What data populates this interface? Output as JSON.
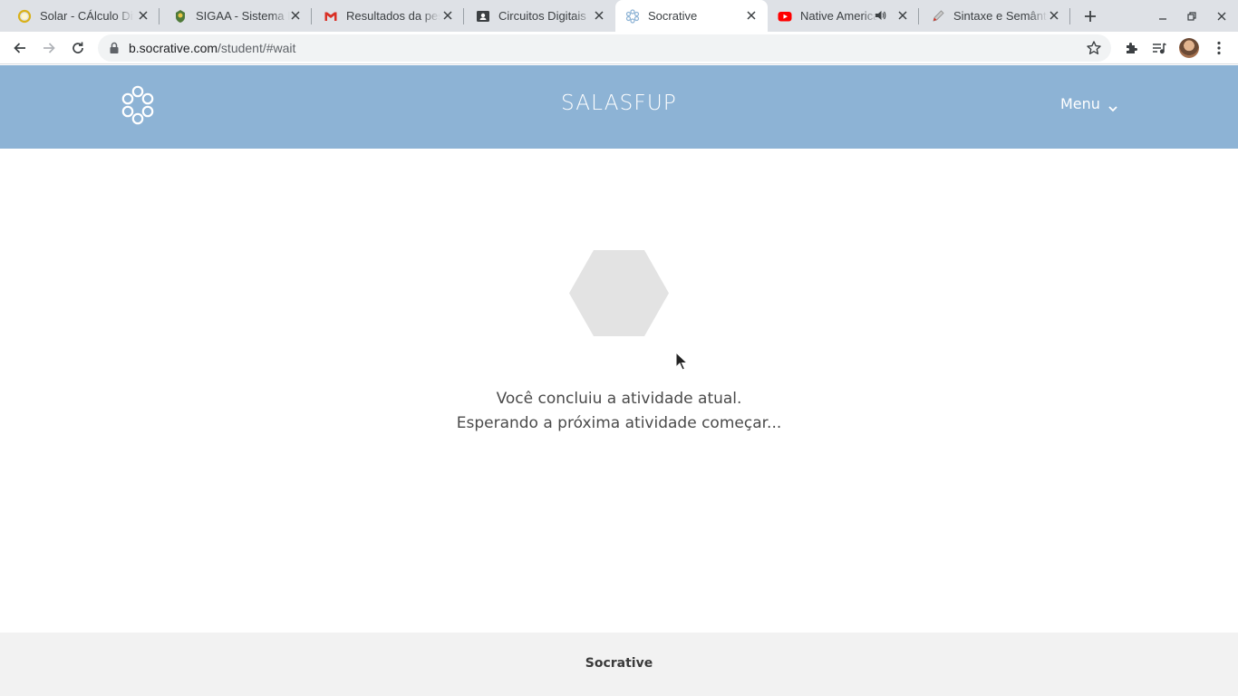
{
  "browser": {
    "tabs": [
      {
        "title": "Solar - CÁlculo Diferencial",
        "favicon": "solar-ring-icon",
        "active": false
      },
      {
        "title": "SIGAA - Sistema Integrado",
        "favicon": "sigaa-crest-icon",
        "active": false
      },
      {
        "title": "Resultados da pesquisa",
        "favicon": "gmail-icon",
        "active": false
      },
      {
        "title": "Circuitos Digitais",
        "favicon": "classroom-icon",
        "active": false
      },
      {
        "title": "Socrative",
        "favicon": "socrative-hex-icon",
        "active": true
      },
      {
        "title": "Native American",
        "favicon": "youtube-icon",
        "active": false,
        "audio": true
      },
      {
        "title": "Sintaxe e Semântica",
        "favicon": "pen-icon",
        "active": false
      }
    ],
    "url": {
      "domain": "b.socrative.com",
      "path": "/student/#wait"
    },
    "colors": {
      "tabstrip": "#dee1e6",
      "omnibox": "#f1f3f4"
    }
  },
  "header": {
    "room_name": "SALASFUP",
    "menu_label": "Menu",
    "background": "#8db3d5"
  },
  "main": {
    "message_line1": "Você concluiu a atividade atual.",
    "message_line2": "Esperando a próxima atividade começar..."
  },
  "footer": {
    "brand": "Socrative"
  }
}
